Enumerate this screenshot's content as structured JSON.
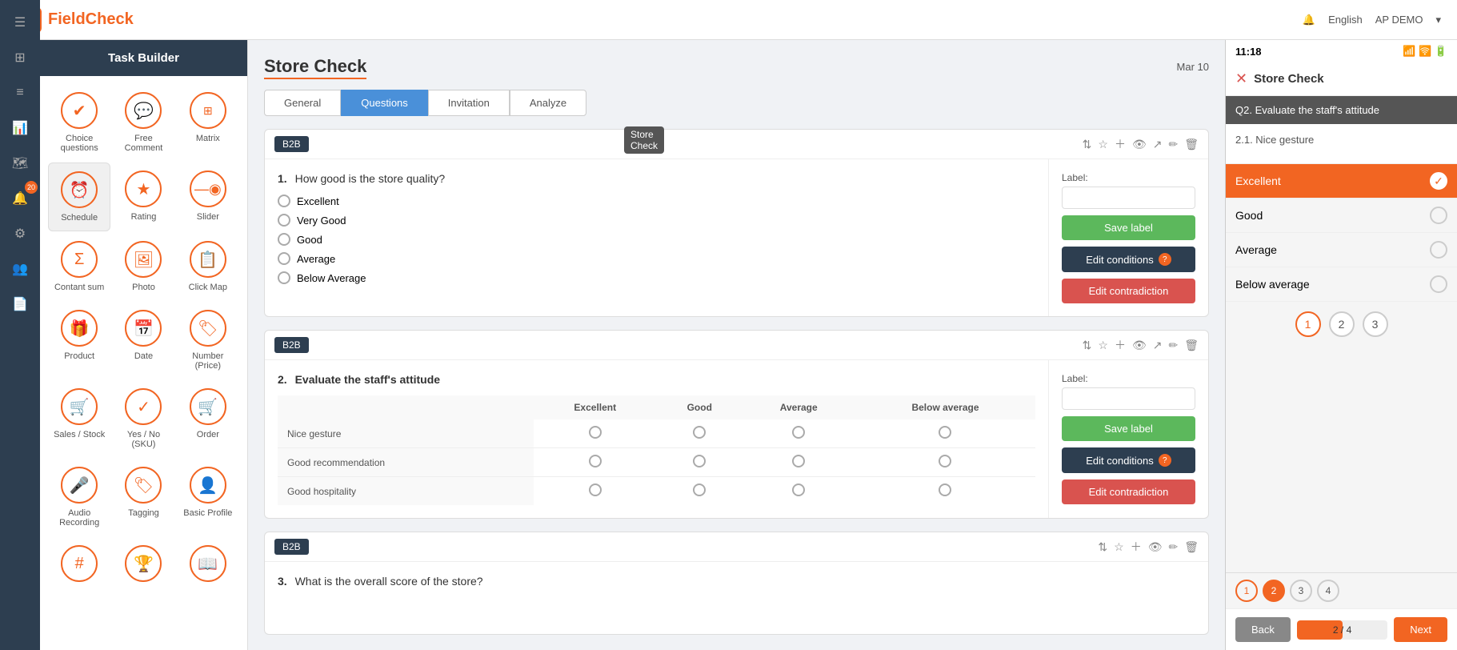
{
  "app": {
    "name": "FieldCheck",
    "logo_icon": "✔"
  },
  "header": {
    "language": "English",
    "user": "AP DEMO"
  },
  "task_builder": {
    "title": "Task Builder",
    "tools": [
      {
        "id": "choice",
        "label": "Choice questions",
        "icon": "✔"
      },
      {
        "id": "comment",
        "label": "Free Comment",
        "icon": "💬"
      },
      {
        "id": "matrix",
        "label": "Matrix",
        "icon": "⊞"
      },
      {
        "id": "schedule",
        "label": "Schedule",
        "icon": "⏰",
        "selected": true
      },
      {
        "id": "rating",
        "label": "Rating",
        "icon": "★"
      },
      {
        "id": "slider",
        "label": "Slider",
        "icon": "—"
      },
      {
        "id": "contant_sum",
        "label": "Contant sum",
        "icon": "Σ"
      },
      {
        "id": "photo",
        "label": "Photo",
        "icon": "🖼"
      },
      {
        "id": "click_map",
        "label": "Click Map",
        "icon": "📋"
      },
      {
        "id": "product",
        "label": "Product",
        "icon": "🎁"
      },
      {
        "id": "date",
        "label": "Date",
        "icon": "📅"
      },
      {
        "id": "number",
        "label": "Number (Price)",
        "icon": "🏷"
      },
      {
        "id": "sales",
        "label": "Sales / Stock",
        "icon": "🛒"
      },
      {
        "id": "yesno",
        "label": "Yes / No (SKU)",
        "icon": "✓"
      },
      {
        "id": "order",
        "label": "Order",
        "icon": "🛒"
      },
      {
        "id": "audio",
        "label": "Audio Recording",
        "icon": "🎤"
      },
      {
        "id": "tagging",
        "label": "Tagging",
        "icon": "🏷"
      },
      {
        "id": "profile",
        "label": "Basic Profile",
        "icon": "👤"
      },
      {
        "id": "hash",
        "label": "",
        "icon": "#"
      },
      {
        "id": "rank",
        "label": "",
        "icon": "🏆"
      },
      {
        "id": "book",
        "label": "",
        "icon": "📖"
      }
    ]
  },
  "store_check": {
    "title": "Store Check",
    "tooltip": "Store Check",
    "date": "Mar 10",
    "tabs": [
      "General",
      "Questions",
      "Invitation",
      "Analyze"
    ],
    "active_tab": "Questions"
  },
  "questions": [
    {
      "number": "1.",
      "text": "How good is the store quality?",
      "type": "B2B",
      "options": [
        "Excellent",
        "Very Good",
        "Good",
        "Average",
        "Below Average"
      ],
      "label_placeholder": "",
      "save_label": "Save label",
      "edit_conditions": "Edit conditions",
      "edit_contradiction": "Edit contradiction"
    },
    {
      "number": "2.",
      "text": "Evaluate the staff's attitude",
      "type": "B2B",
      "matrix_rows": [
        "Nice gesture",
        "Good recommendation",
        "Good hospitality"
      ],
      "matrix_cols": [
        "Excellent",
        "Good",
        "Average",
        "Below average"
      ],
      "label_placeholder": "",
      "save_label": "Save label",
      "edit_conditions": "Edit conditions",
      "edit_contradiction": "Edit contradiction"
    },
    {
      "number": "3.",
      "text": "What is the overall score of the store?",
      "type": "B2B"
    }
  ],
  "mobile_preview": {
    "time": "11:18",
    "title": "Store Check",
    "question_header": "Q2. Evaluate the staff's attitude",
    "section_title": "2.1. Nice gesture",
    "options": [
      {
        "label": "Excellent",
        "selected": true
      },
      {
        "label": "Good",
        "selected": false
      },
      {
        "label": "Average",
        "selected": false
      },
      {
        "label": "Below average",
        "selected": false
      }
    ],
    "step_dots": [
      1,
      2,
      3
    ],
    "back_label": "Back",
    "progress": "2 / 4",
    "progress_pct": 50,
    "next_label": "Next",
    "step_indicators": [
      {
        "num": 1,
        "state": "normal"
      },
      {
        "num": 2,
        "state": "active"
      },
      {
        "num": 3,
        "state": "normal"
      },
      {
        "num": 4,
        "state": "normal"
      }
    ]
  }
}
